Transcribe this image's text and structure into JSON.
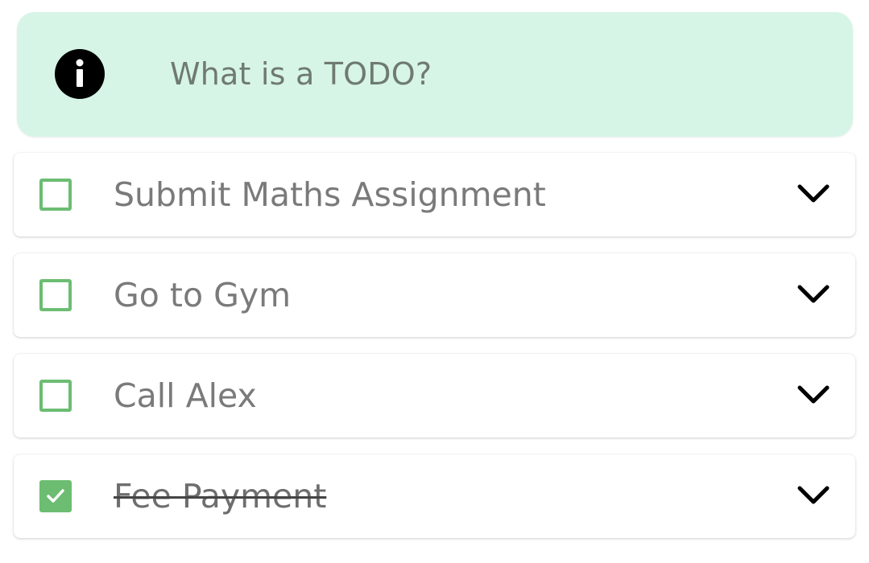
{
  "info_banner": {
    "text": "What is a TODO?",
    "icon": "info-icon",
    "background_color": "#d7f5e6"
  },
  "todos": [
    {
      "label": "Submit Maths Assignment",
      "checked": false,
      "icon": "chevron-down-icon"
    },
    {
      "label": "Go to Gym",
      "checked": false,
      "icon": "chevron-down-icon"
    },
    {
      "label": "Call Alex",
      "checked": false,
      "icon": "chevron-down-icon"
    },
    {
      "label": "Fee Payment",
      "checked": true,
      "icon": "chevron-down-icon"
    }
  ],
  "colors": {
    "checkbox_accent": "#6cbd72",
    "text": "#7a7a7a"
  }
}
